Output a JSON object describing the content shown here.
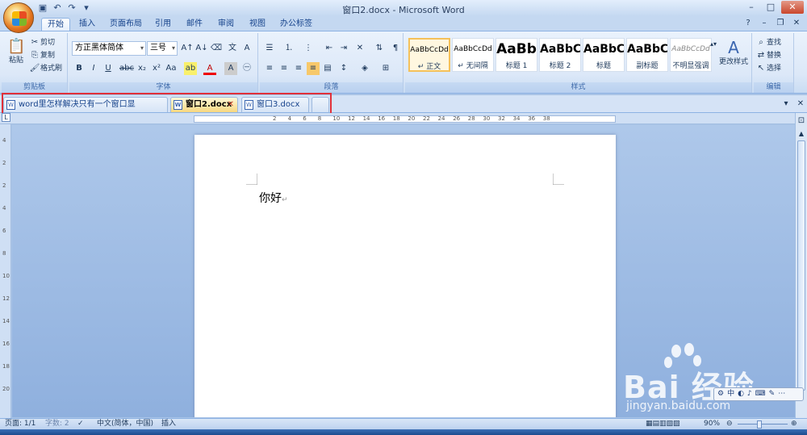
{
  "window": {
    "title": "窗口2.docx - Microsoft Word"
  },
  "ribbon_tabs": [
    "开始",
    "插入",
    "页面布局",
    "引用",
    "邮件",
    "审阅",
    "视图",
    "办公标签"
  ],
  "clipboard": {
    "paste": "粘贴",
    "cut": "剪切",
    "copy": "复制",
    "format_painter": "格式刷",
    "group_label": "剪贴板"
  },
  "font": {
    "family": "方正黑体简体",
    "size": "三号",
    "group_label": "字体"
  },
  "paragraph": {
    "group_label": "段落"
  },
  "styles": {
    "group_label": "样式",
    "items": [
      {
        "sample": "AaBbCcDd",
        "name": "↵ 正文"
      },
      {
        "sample": "AaBbCcDd",
        "name": "↵ 无间隔"
      },
      {
        "sample": "AaBb",
        "name": "标题 1"
      },
      {
        "sample": "AaBbC",
        "name": "标题 2"
      },
      {
        "sample": "AaBbC",
        "name": "标题"
      },
      {
        "sample": "AaBbC",
        "name": "副标题"
      },
      {
        "sample": "AaBbCcDd",
        "name": "不明显强调"
      }
    ],
    "change_styles": "更改样式"
  },
  "editing": {
    "find": "查找",
    "replace": "替换",
    "select": "选择",
    "group_label": "编辑"
  },
  "doc_tabs": [
    {
      "label": "word里怎样解决只有一个窗口显示。.docx",
      "active": false
    },
    {
      "label": "窗口2.docx",
      "active": true
    },
    {
      "label": "窗口3.docx",
      "active": false
    }
  ],
  "ruler": {
    "h_numbers": [
      "2",
      "4",
      "6",
      "8",
      "10",
      "12",
      "14",
      "16",
      "18",
      "20",
      "22",
      "24",
      "26",
      "28",
      "30",
      "32",
      "34",
      "36",
      "38"
    ],
    "v_numbers": [
      "4",
      "2",
      "2",
      "4",
      "6",
      "8",
      "10",
      "12",
      "14",
      "16",
      "18",
      "20"
    ]
  },
  "document": {
    "text": "你好",
    "pilcrow": "↵"
  },
  "status": {
    "page": "页面: 1/1",
    "words": "字数: 2",
    "language": "中文(简体，中国)",
    "mode": "插入",
    "zoom": "90%"
  },
  "watermark": {
    "brand": "Bai 经验",
    "url": "jingyan.baidu.com"
  },
  "colors": {
    "ribbon_bg": "#dce8f8",
    "highlight_border": "#e0303a",
    "active_tab": "#f7d780"
  }
}
